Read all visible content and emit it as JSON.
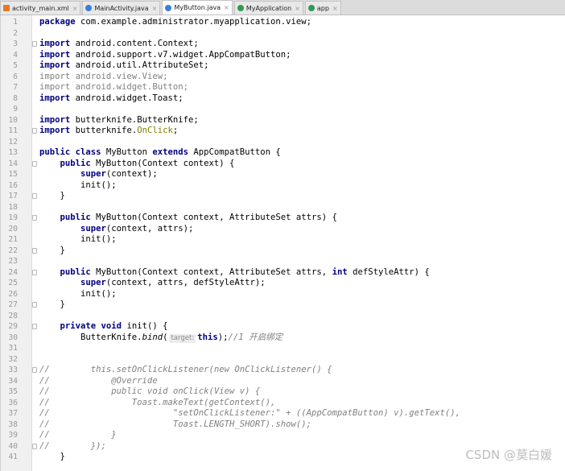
{
  "tabs": [
    {
      "label": "activity_main.xml",
      "icon": "xml",
      "active": false
    },
    {
      "label": "MainActivity.java",
      "icon": "cls",
      "active": false
    },
    {
      "label": "MyButton.java",
      "icon": "cls",
      "active": true
    },
    {
      "label": "MyApplication",
      "icon": "mod",
      "active": false
    },
    {
      "label": "app",
      "icon": "mod",
      "active": false
    }
  ],
  "tab_close_glyph": "×",
  "lines": [
    {
      "n": "1",
      "fold": false,
      "t": [
        [
          "kw",
          "package"
        ],
        [
          "n",
          " com.example.administrator.myapplication.view;"
        ]
      ]
    },
    {
      "n": "2",
      "fold": false,
      "t": []
    },
    {
      "n": "3",
      "fold": true,
      "t": [
        [
          "kw",
          "import"
        ],
        [
          "n",
          " android.content.Context;"
        ]
      ]
    },
    {
      "n": "4",
      "fold": false,
      "t": [
        [
          "kw",
          "import"
        ],
        [
          "n",
          " android.support.v7.widget.AppCompatButton;"
        ]
      ]
    },
    {
      "n": "5",
      "fold": false,
      "t": [
        [
          "kw",
          "import"
        ],
        [
          "n",
          " android.util.AttributeSet;"
        ]
      ]
    },
    {
      "n": "6",
      "fold": false,
      "t": [
        [
          "gray",
          "import android.view.View;"
        ]
      ]
    },
    {
      "n": "7",
      "fold": false,
      "t": [
        [
          "gray",
          "import android.widget.Button;"
        ]
      ]
    },
    {
      "n": "8",
      "fold": false,
      "t": [
        [
          "kw",
          "import"
        ],
        [
          "n",
          " android.widget.Toast;"
        ]
      ]
    },
    {
      "n": "9",
      "fold": false,
      "t": []
    },
    {
      "n": "10",
      "fold": false,
      "t": [
        [
          "kw",
          "import"
        ],
        [
          "n",
          " butterknife.ButterKnife;"
        ]
      ]
    },
    {
      "n": "11",
      "fold": true,
      "t": [
        [
          "kw",
          "import"
        ],
        [
          "n",
          " butterknife."
        ],
        [
          "ann",
          "OnClick"
        ],
        [
          "n",
          ";"
        ]
      ]
    },
    {
      "n": "12",
      "fold": false,
      "t": []
    },
    {
      "n": "13",
      "fold": false,
      "t": [
        [
          "kw",
          "public class"
        ],
        [
          "n",
          " MyButton "
        ],
        [
          "kw",
          "extends"
        ],
        [
          "n",
          " AppCompatButton {"
        ]
      ]
    },
    {
      "n": "14",
      "fold": true,
      "t": [
        [
          "n",
          "    "
        ],
        [
          "kw",
          "public"
        ],
        [
          "n",
          " MyButton(Context context) {"
        ]
      ]
    },
    {
      "n": "15",
      "fold": false,
      "t": [
        [
          "n",
          "        "
        ],
        [
          "kw",
          "super"
        ],
        [
          "n",
          "(context);"
        ]
      ]
    },
    {
      "n": "16",
      "fold": false,
      "t": [
        [
          "n",
          "        init();"
        ]
      ]
    },
    {
      "n": "17",
      "fold": true,
      "t": [
        [
          "n",
          "    }"
        ]
      ]
    },
    {
      "n": "18",
      "fold": false,
      "t": []
    },
    {
      "n": "19",
      "fold": true,
      "t": [
        [
          "n",
          "    "
        ],
        [
          "kw",
          "public"
        ],
        [
          "n",
          " MyButton(Context context, AttributeSet attrs) {"
        ]
      ]
    },
    {
      "n": "20",
      "fold": false,
      "t": [
        [
          "n",
          "        "
        ],
        [
          "kw",
          "super"
        ],
        [
          "n",
          "(context, attrs);"
        ]
      ]
    },
    {
      "n": "21",
      "fold": false,
      "t": [
        [
          "n",
          "        init();"
        ]
      ]
    },
    {
      "n": "22",
      "fold": true,
      "t": [
        [
          "n",
          "    }"
        ]
      ]
    },
    {
      "n": "23",
      "fold": false,
      "t": []
    },
    {
      "n": "24",
      "fold": true,
      "t": [
        [
          "n",
          "    "
        ],
        [
          "kw",
          "public"
        ],
        [
          "n",
          " MyButton(Context context, AttributeSet attrs, "
        ],
        [
          "kw",
          "int"
        ],
        [
          "n",
          " defStyleAttr) {"
        ]
      ]
    },
    {
      "n": "25",
      "fold": false,
      "t": [
        [
          "n",
          "        "
        ],
        [
          "kw",
          "super"
        ],
        [
          "n",
          "(context, attrs, defStyleAttr);"
        ]
      ]
    },
    {
      "n": "26",
      "fold": false,
      "t": [
        [
          "n",
          "        init();"
        ]
      ]
    },
    {
      "n": "27",
      "fold": true,
      "t": [
        [
          "n",
          "    }"
        ]
      ]
    },
    {
      "n": "28",
      "fold": false,
      "t": []
    },
    {
      "n": "29",
      "fold": true,
      "t": [
        [
          "n",
          "    "
        ],
        [
          "kw",
          "private void"
        ],
        [
          "n",
          " init() {"
        ]
      ]
    },
    {
      "n": "30",
      "fold": false,
      "t": [
        [
          "n",
          "        ButterKnife."
        ],
        [
          "it",
          "bind"
        ],
        [
          "n",
          "("
        ],
        [
          "hint",
          "target:"
        ],
        [
          "kw",
          "this"
        ],
        [
          "n",
          ");"
        ],
        [
          "cmt",
          "//1 开启绑定"
        ]
      ]
    },
    {
      "n": "31",
      "fold": false,
      "t": []
    },
    {
      "n": "32",
      "fold": false,
      "t": []
    },
    {
      "n": "33",
      "fold": true,
      "t": [
        [
          "cmt",
          "//        this.setOnClickListener(new OnClickListener() {"
        ]
      ]
    },
    {
      "n": "34",
      "fold": false,
      "t": [
        [
          "cmt",
          "//            @Override"
        ]
      ]
    },
    {
      "n": "35",
      "fold": false,
      "t": [
        [
          "cmt",
          "//            public void onClick(View v) {"
        ]
      ]
    },
    {
      "n": "36",
      "fold": false,
      "t": [
        [
          "cmt",
          "//                Toast.makeText(getContext(),"
        ]
      ]
    },
    {
      "n": "37",
      "fold": false,
      "t": [
        [
          "cmt",
          "//                        \"setOnClickListener:\" + ((AppCompatButton) v).getText(),"
        ]
      ]
    },
    {
      "n": "38",
      "fold": false,
      "t": [
        [
          "cmt",
          "//                        Toast.LENGTH_SHORT).show();"
        ]
      ]
    },
    {
      "n": "39",
      "fold": false,
      "t": [
        [
          "cmt",
          "//            }"
        ]
      ]
    },
    {
      "n": "40",
      "fold": true,
      "t": [
        [
          "cmt",
          "//        });"
        ]
      ]
    },
    {
      "n": "41",
      "fold": false,
      "t": [
        [
          "n",
          "    }"
        ]
      ]
    }
  ],
  "watermark": "CSDN @莫白媛"
}
